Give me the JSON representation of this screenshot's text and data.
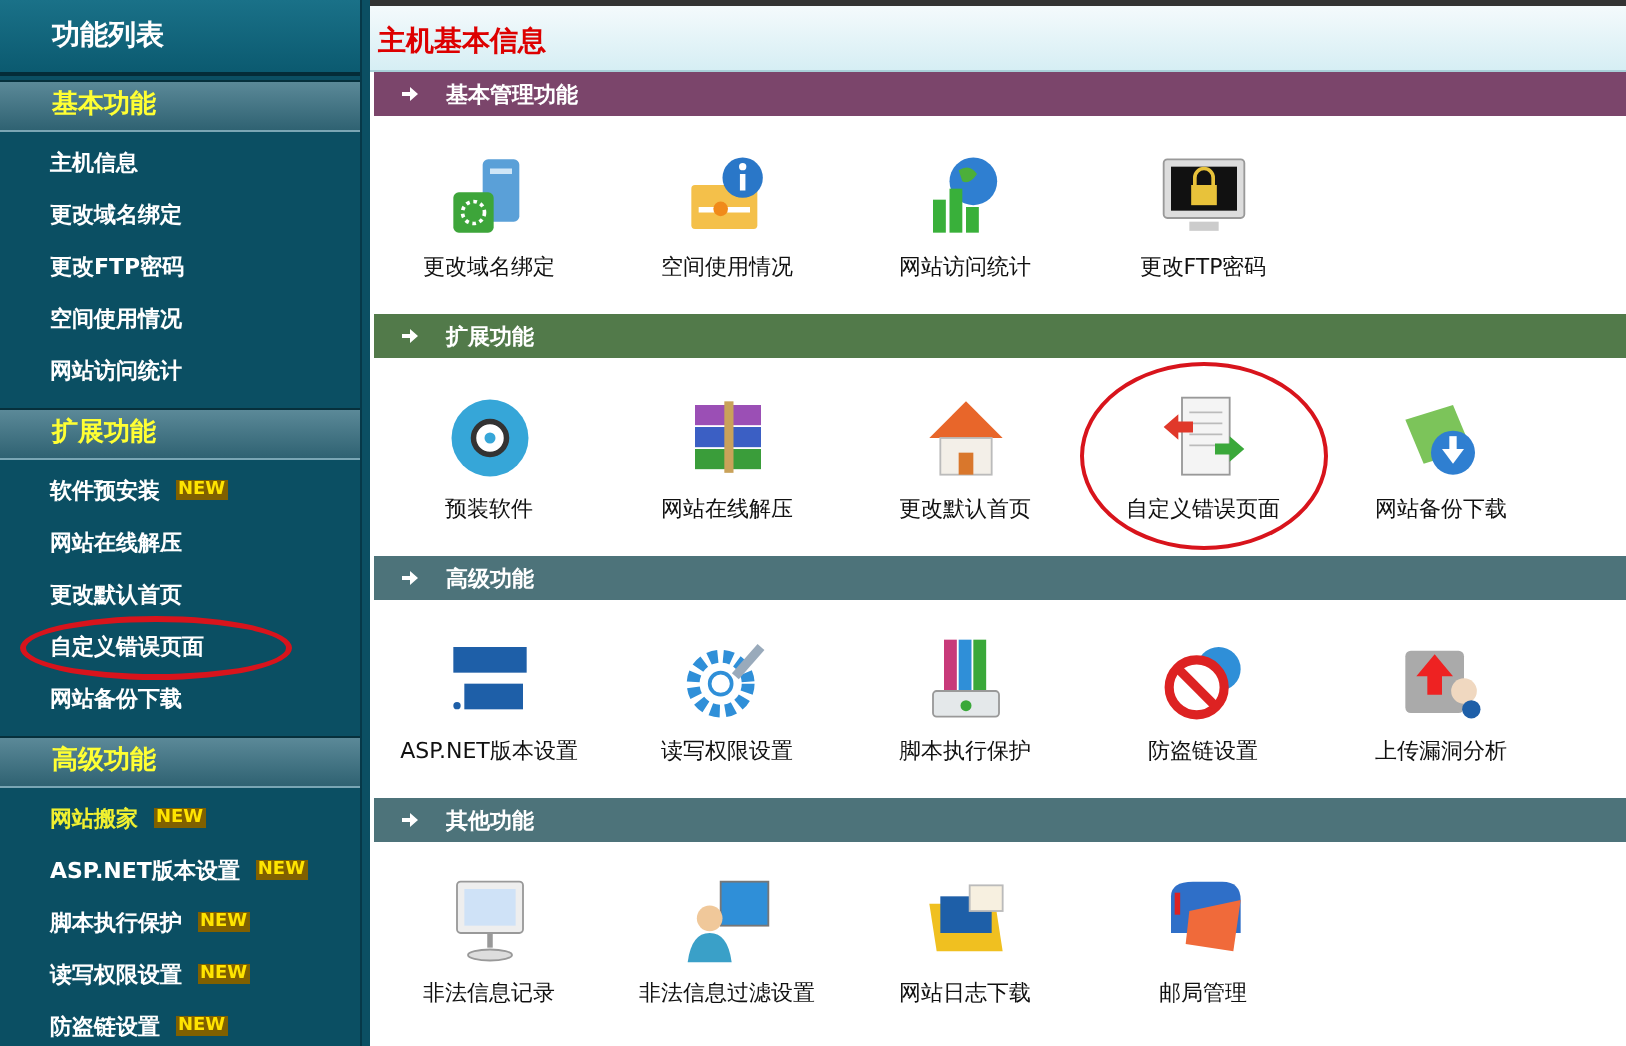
{
  "sidebar": {
    "title": "功能列表",
    "sections": [
      {
        "title": "基本功能",
        "items": [
          {
            "label": "主机信息",
            "selected": false,
            "circled": false
          },
          {
            "label": "更改域名绑定",
            "selected": false,
            "circled": false
          },
          {
            "label": "更改FTP密码",
            "selected": false,
            "circled": false
          },
          {
            "label": "空间使用情况",
            "selected": false,
            "circled": false
          },
          {
            "label": "网站访问统计",
            "selected": false,
            "circled": false
          }
        ]
      },
      {
        "title": "扩展功能",
        "items": [
          {
            "label": "软件预安装",
            "badge": "NEW",
            "selected": false,
            "circled": false
          },
          {
            "label": "网站在线解压",
            "selected": false,
            "circled": false
          },
          {
            "label": "更改默认首页",
            "selected": false,
            "circled": false
          },
          {
            "label": "自定义错误页面",
            "selected": false,
            "circled": true
          },
          {
            "label": "网站备份下载",
            "selected": false,
            "circled": false
          }
        ]
      },
      {
        "title": "高级功能",
        "items": [
          {
            "label": "网站搬家",
            "badge": "NEW",
            "selected": true,
            "circled": false
          },
          {
            "label": "ASP.NET版本设置",
            "badge": "NEW",
            "selected": false,
            "circled": false
          },
          {
            "label": "脚本执行保护",
            "badge": "NEW",
            "selected": false,
            "circled": false
          },
          {
            "label": "读写权限设置",
            "badge": "NEW",
            "selected": false,
            "circled": false
          },
          {
            "label": "防盗链设置",
            "badge": "NEW",
            "selected": false,
            "circled": false
          }
        ]
      }
    ]
  },
  "main": {
    "title": "主机基本信息",
    "sections": [
      {
        "title": "基本管理功能",
        "color": "#7b456b",
        "items": [
          {
            "label": "更改域名绑定",
            "circled": false
          },
          {
            "label": "空间使用情况",
            "circled": false
          },
          {
            "label": "网站访问统计",
            "circled": false
          },
          {
            "label": "更改FTP密码",
            "circled": false
          }
        ]
      },
      {
        "title": "扩展功能",
        "color": "#527a4a",
        "items": [
          {
            "label": "预装软件",
            "circled": false
          },
          {
            "label": "网站在线解压",
            "circled": false
          },
          {
            "label": "更改默认首页",
            "circled": false
          },
          {
            "label": "自定义错误页面",
            "circled": true
          },
          {
            "label": "网站备份下载",
            "circled": false
          }
        ]
      },
      {
        "title": "高级功能",
        "color": "#4d737a",
        "items": [
          {
            "label": "ASP.NET版本设置",
            "circled": false
          },
          {
            "label": "读写权限设置",
            "circled": false
          },
          {
            "label": "脚本执行保护",
            "circled": false
          },
          {
            "label": "防盗链设置",
            "circled": false
          },
          {
            "label": "上传漏洞分析",
            "circled": false
          }
        ]
      },
      {
        "title": "其他功能",
        "color": "#4d737a",
        "items": [
          {
            "label": "非法信息记录",
            "circled": false
          },
          {
            "label": "非法信息过滤设置",
            "circled": false
          },
          {
            "label": "网站日志下载",
            "circled": false
          },
          {
            "label": "邮局管理",
            "circled": false
          }
        ]
      }
    ]
  }
}
